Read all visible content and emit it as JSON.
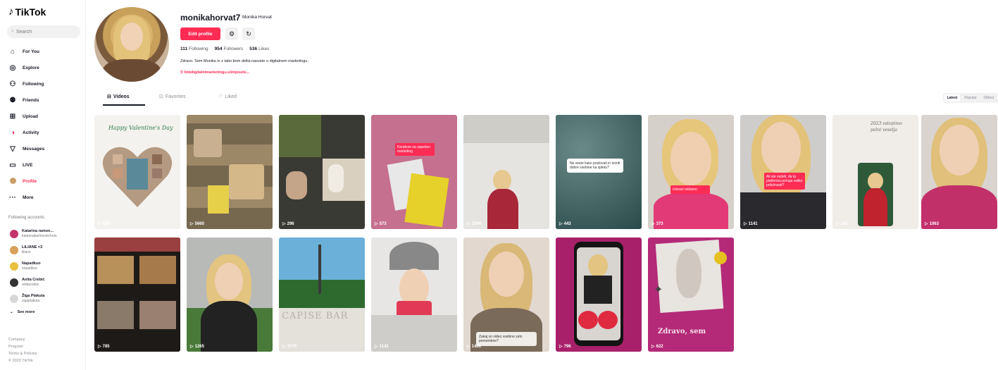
{
  "sidebar": {
    "logo": "TikTok",
    "search_placeholder": "Search",
    "nav": [
      {
        "label": "For You",
        "icon": "home-icon"
      },
      {
        "label": "Explore",
        "icon": "compass-icon"
      },
      {
        "label": "Following",
        "icon": "following-icon"
      },
      {
        "label": "Friends",
        "icon": "friends-icon"
      },
      {
        "label": "Upload",
        "icon": "upload-icon"
      },
      {
        "label": "Activity",
        "icon": "activity-icon"
      },
      {
        "label": "Messages",
        "icon": "messages-icon"
      },
      {
        "label": "LIVE",
        "icon": "live-icon"
      },
      {
        "label": "Profile",
        "icon": "profile-icon",
        "active": true
      },
      {
        "label": "More",
        "icon": "more-icon"
      }
    ],
    "following_title": "Following accounts",
    "following": [
      {
        "name": "Katarina ramon...",
        "handle": "katarinakarlovovicholu"
      },
      {
        "name": "LILIANE <3",
        "handle": "liliane"
      },
      {
        "name": "Napadkuo",
        "handle": "enpadkuo"
      },
      {
        "name": "Anita Crebić",
        "handle": "anitacrebic"
      },
      {
        "name": "Žiga Plakuta",
        "handle": "zigaplakuta"
      }
    ],
    "see_more": "See more",
    "footer": [
      "Company",
      "Program",
      "Terms & Policies",
      "© 2023 TikTok"
    ]
  },
  "profile": {
    "username": "monikahorvat7",
    "display_name": "Monika Horvat",
    "edit_label": "Edit profile",
    "following_count": "111",
    "following_label": "Following",
    "followers_count": "954",
    "followers_label": "Followers",
    "likes_count": "536",
    "likes_label": "Likes",
    "bio": "Zdravo. Sem Monika in z tabo bom delila nasvete o digitalnem marketingu.",
    "link": "linkdigitalnimarketingu.si/mjesele..."
  },
  "tabs": {
    "videos": "Videos",
    "favorites": "Favorites",
    "liked": "Liked"
  },
  "sort": [
    "Latest",
    "Popular",
    "Oldest"
  ],
  "videos": [
    {
      "views": "529",
      "text": "Happy Valentine's Day"
    },
    {
      "views": "5660"
    },
    {
      "views": "296"
    },
    {
      "views": "573",
      "caption": "Korakom za uspešen marketing"
    },
    {
      "views": "1094"
    },
    {
      "views": "443",
      "caption": "Ne veste kako poslovati in tvoriti dobre vsebine na spletu?"
    },
    {
      "views": "373",
      "caption": "Ustvari reklamo"
    },
    {
      "views": "1141",
      "caption": "Ali ste vedeli, da ta platforma ponuja veliko priložnosti?"
    },
    {
      "views": "365",
      "text": "2023 vstopimo polni veselja"
    },
    {
      "views": "1063"
    },
    {
      "views": "785"
    },
    {
      "views": "1265"
    },
    {
      "views": "1579",
      "text": "CAPISE BAR"
    },
    {
      "views": "1142"
    },
    {
      "views": "1466",
      "caption": "Zakaj so video vsebine zelo pomembne?"
    },
    {
      "views": "796"
    },
    {
      "views": "622",
      "text": "Zdravo, sem"
    }
  ]
}
